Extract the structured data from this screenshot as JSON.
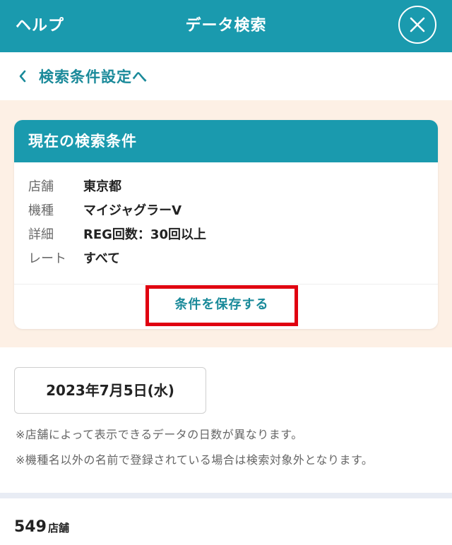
{
  "header": {
    "help_label": "ヘルプ",
    "title": "データ検索"
  },
  "back": {
    "label": "検索条件設定へ"
  },
  "conditions": {
    "title": "現在の検索条件",
    "rows": [
      {
        "key": "店舗",
        "value": "東京都"
      },
      {
        "key": "機種",
        "value": "マイジャグラーV"
      },
      {
        "key": "詳細",
        "value": "REG回数：30回以上"
      },
      {
        "key": "レート",
        "value": "すべて"
      }
    ],
    "save_label": "条件を保存する"
  },
  "date": {
    "label": "2023年7月5日(水)"
  },
  "notes": [
    "※店舗によって表示できるデータの日数が異なります。",
    "※機種名以外の名前で登録されている場合は検索対象外となります。"
  ],
  "result": {
    "count": "549",
    "unit": "店舗"
  },
  "colors": {
    "brand": "#1a9aae",
    "highlight_border": "#e00010",
    "condition_bg": "#fdf0e5"
  }
}
